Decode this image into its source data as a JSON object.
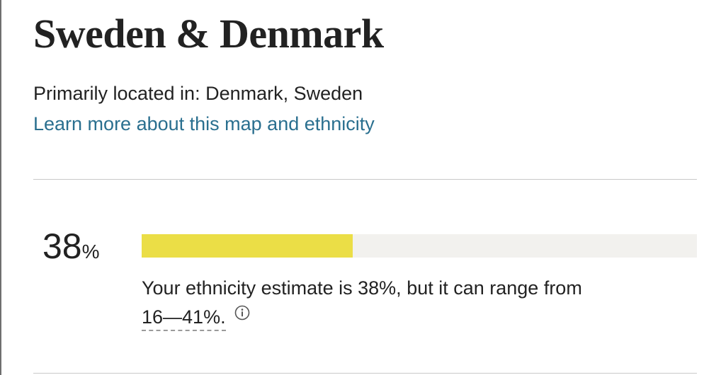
{
  "region": {
    "title": "Sweden & Denmark",
    "located_text": "Primarily located in: Denmark, Sweden",
    "learn_more_link": "Learn more about this map and ethnicity"
  },
  "estimate": {
    "percent_value": "38",
    "percent_sign": "%",
    "fraction": 0.38,
    "bar_color": "#ebde46",
    "track_color": "#f2f1ee",
    "description": "Your ethnicity estimate is 38%, but it can range from",
    "range_text": "16—41%.",
    "info_icon": "info-icon"
  },
  "colors": {
    "link": "#2a6f8f",
    "text": "#222222"
  }
}
